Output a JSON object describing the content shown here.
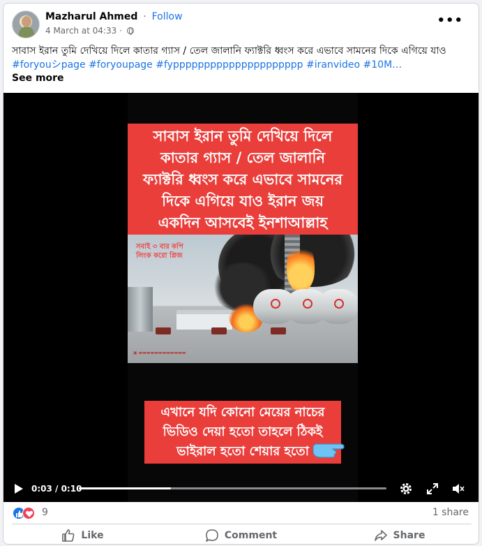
{
  "post": {
    "author": "Mazharul Ahmed",
    "separator": "·",
    "follow_label": "Follow",
    "timestamp": "4 March at 04:33",
    "meta_separator": "·",
    "privacy_icon": "globe-icon",
    "more_label": "•••",
    "caption_text": "সাবাস ইরান তুমি দেখিয়ে দিলে কাতার গ্যাস / তেল জালানি ফ্যাক্টরি ধ্বংস করে এভাবে সামনের দিকে এগিয়ে যাও ",
    "hashtags": "#foryouシpage #foryoupage #fyppppppppppppppppppppp #iranvideo #10M…",
    "see_more": "See more"
  },
  "video": {
    "banner_top": "সাবাস ইরান তুমি দেখিয়ে দিলে\nকাতার গ্যাস / তেল জালানি\nফ্যাক্টরি ধ্বংস করে এভাবে সামনের\nদিকে এগিয়ে যাও ইরান জয়\nএকদিন আসবেই ইনশাআল্লাহ",
    "overlay_text": "সবাই ৩ বার কপি\nলিংক করো প্লিজ",
    "banner_bottom": "এখানে যদি কোনো মেয়ের নাচের\nভিডিও দেয়া হতো তাহলে ঠিকই\nভাইরাল হতো শেয়ার হতো",
    "time": "0:03 / 0:10",
    "progress": 0.3,
    "icons": [
      "play-icon",
      "settings-icon",
      "fullscreen-icon",
      "mute-icon"
    ]
  },
  "engagement": {
    "reaction_count": "9",
    "shares": "1 share",
    "like_label": "Like",
    "comment_label": "Comment",
    "share_label": "Share"
  },
  "colors": {
    "accent": "#1b74e4",
    "banner_red": "#ea3e3b",
    "love": "#f33e58"
  }
}
